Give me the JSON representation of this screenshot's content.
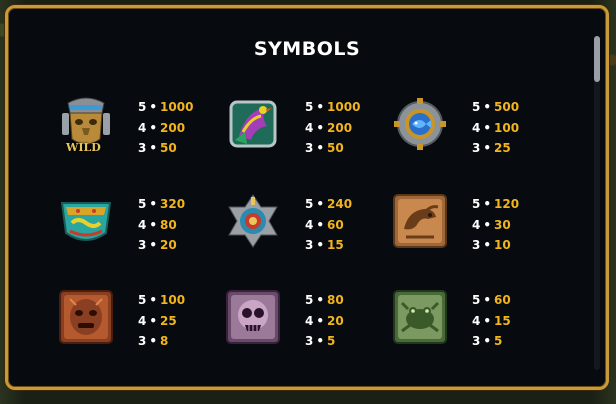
{
  "title": "SYMBOLS",
  "colors": {
    "frame": "#c99a3a",
    "panel": "#070a0e",
    "count": "#ffffff",
    "value": "#f2b51e"
  },
  "symbols": [
    {
      "name": "wild-mask-icon",
      "wild_label": "WILD",
      "pays": [
        {
          "count": "5",
          "value": "1000"
        },
        {
          "count": "4",
          "value": "200"
        },
        {
          "count": "3",
          "value": "50"
        }
      ]
    },
    {
      "name": "quetzal-bird-icon",
      "pays": [
        {
          "count": "5",
          "value": "1000"
        },
        {
          "count": "4",
          "value": "200"
        },
        {
          "count": "3",
          "value": "50"
        }
      ]
    },
    {
      "name": "fish-medallion-icon",
      "pays": [
        {
          "count": "5",
          "value": "500"
        },
        {
          "count": "4",
          "value": "100"
        },
        {
          "count": "3",
          "value": "25"
        }
      ]
    },
    {
      "name": "serpent-shield-icon",
      "pays": [
        {
          "count": "5",
          "value": "320"
        },
        {
          "count": "4",
          "value": "80"
        },
        {
          "count": "3",
          "value": "20"
        }
      ]
    },
    {
      "name": "sun-calendar-icon",
      "pays": [
        {
          "count": "5",
          "value": "240"
        },
        {
          "count": "4",
          "value": "60"
        },
        {
          "count": "3",
          "value": "15"
        }
      ]
    },
    {
      "name": "eagle-glyph-tile-icon",
      "pays": [
        {
          "count": "5",
          "value": "120"
        },
        {
          "count": "4",
          "value": "30"
        },
        {
          "count": "3",
          "value": "10"
        }
      ]
    },
    {
      "name": "copper-face-tile-icon",
      "pays": [
        {
          "count": "5",
          "value": "100"
        },
        {
          "count": "4",
          "value": "25"
        },
        {
          "count": "3",
          "value": "8"
        }
      ]
    },
    {
      "name": "purple-skull-tile-icon",
      "pays": [
        {
          "count": "5",
          "value": "80"
        },
        {
          "count": "4",
          "value": "20"
        },
        {
          "count": "3",
          "value": "5"
        }
      ]
    },
    {
      "name": "green-frog-tile-icon",
      "pays": [
        {
          "count": "5",
          "value": "60"
        },
        {
          "count": "4",
          "value": "15"
        },
        {
          "count": "3",
          "value": "5"
        }
      ]
    }
  ]
}
